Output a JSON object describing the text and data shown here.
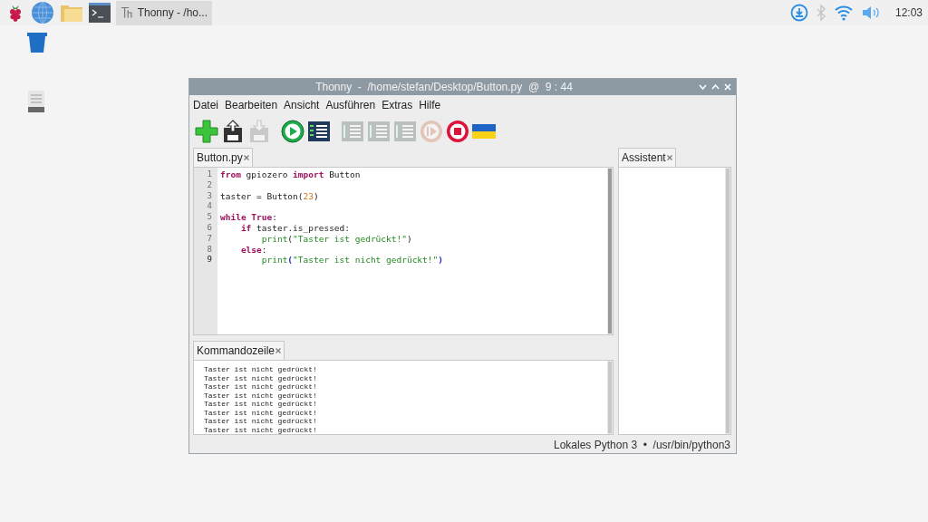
{
  "taskbar": {
    "launchers": [
      {
        "kind": "raspberry"
      },
      {
        "kind": "globe"
      },
      {
        "kind": "folder"
      },
      {
        "kind": "terminal"
      }
    ],
    "task": {
      "label": "Thonny  -  /ho...",
      "selected": true
    },
    "tray": [
      {
        "kind": "download"
      },
      {
        "kind": "bluetooth",
        "on": false
      },
      {
        "kind": "wifi"
      },
      {
        "kind": "volume"
      }
    ],
    "clock": "12:03"
  },
  "desktop_icons": [
    {
      "kind": "trash"
    },
    {
      "kind": "drive"
    }
  ],
  "window": {
    "title": "Thonny  -  /home/stefan/Desktop/Button.py  @  9 : 44",
    "menu": [
      "Datei",
      "Bearbeiten",
      "Ansicht",
      "Ausführen",
      "Extras",
      "Hilfe"
    ],
    "toolbar": [
      {
        "kind": "new",
        "disabled": false
      },
      {
        "kind": "load",
        "disabled": false
      },
      {
        "kind": "save",
        "disabled": true
      },
      {
        "kind": "run",
        "disabled": false
      },
      {
        "kind": "debug",
        "disabled": false
      },
      {
        "kind": "step",
        "disabled": true
      },
      {
        "kind": "step",
        "disabled": true
      },
      {
        "kind": "step",
        "disabled": true
      },
      {
        "kind": "resume",
        "disabled": true
      },
      {
        "kind": "stop",
        "disabled": false
      },
      {
        "kind": "flag",
        "disabled": false
      }
    ],
    "editor": {
      "tab": "Button.py",
      "lines": [
        {
          "number": "1",
          "current": false,
          "tokens": [
            {
              "kind": "keyword",
              "text": "from"
            },
            {
              "kind": "plain",
              "text": " gpiozero "
            },
            {
              "kind": "keyword",
              "text": "import"
            },
            {
              "kind": "plain",
              "text": " Button"
            }
          ]
        },
        {
          "number": "2",
          "current": false
        },
        {
          "number": "3",
          "current": false,
          "tokens": [
            {
              "kind": "plain",
              "text": "taster = Button("
            },
            {
              "kind": "number",
              "text": "23"
            },
            {
              "kind": "plain",
              "text": ")"
            }
          ]
        },
        {
          "number": "4",
          "current": false
        },
        {
          "number": "5",
          "current": false,
          "tokens": [
            {
              "kind": "keyword",
              "text": "while"
            },
            {
              "kind": "keyword",
              "text": "True"
            },
            {
              "kind": "plain",
              "text": ":"
            }
          ],
          "children": [
            {
              "number": "6",
              "current": false,
              "tokens": [
                {
                  "kind": "keyword",
                  "text": "if"
                },
                {
                  "kind": "plain",
                  "text": "taster.is_pressed:"
                }
              ],
              "children": [
                {
                  "number": "7",
                  "current": false,
                  "tokens": [
                    {
                      "kind": "builtin",
                      "text": "print"
                    },
                    {
                      "kind": "plain",
                      "text": "("
                    },
                    {
                      "kind": "string",
                      "text": "\"Taster ist gedrückt!\""
                    },
                    {
                      "kind": "plain",
                      "text": ")"
                    }
                  ]
                }
              ]
            },
            {
              "number": "8",
              "current": false,
              "tokens": [
                {
                  "kind": "keyword",
                  "text": "else"
                },
                {
                  "kind": "plain",
                  "text": ":"
                }
              ],
              "children": [
                {
                  "number": "9",
                  "current": true,
                  "tokens": [
                    {
                      "kind": "builtin",
                      "text": "print"
                    },
                    {
                      "kind": "bracket",
                      "text": "("
                    },
                    {
                      "kind": "string",
                      "text": "\"Taster ist nicht gedrückt!\""
                    },
                    {
                      "kind": "bracket",
                      "text": ")"
                    }
                  ]
                }
              ]
            }
          ]
        }
      ]
    },
    "shell": {
      "tab": "Kommandozeile",
      "lines": [
        "Taster ist nicht gedrückt!",
        "Taster ist nicht gedrückt!",
        "Taster ist nicht gedrückt!",
        "Taster ist nicht gedrückt!",
        "Taster ist nicht gedrückt!",
        "Taster ist nicht gedrückt!",
        "Taster ist nicht gedrückt!",
        "Taster ist nicht gedrückt!"
      ]
    },
    "assistant": {
      "tab": "Assistent"
    },
    "status": "Lokales Python 3  •  /usr/bin/python3"
  }
}
